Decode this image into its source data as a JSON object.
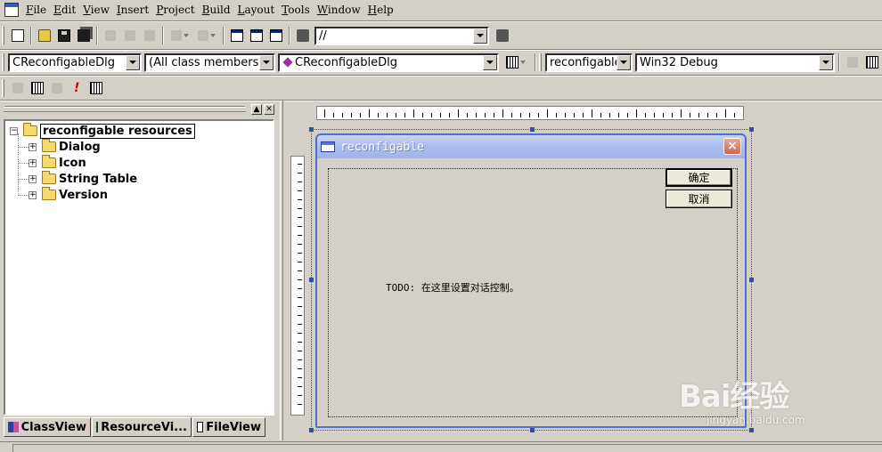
{
  "menu": [
    "File",
    "Edit",
    "View",
    "Insert",
    "Project",
    "Build",
    "Layout",
    "Tools",
    "Window",
    "Help"
  ],
  "toolbar": {
    "find_combo_value": "//",
    "class_combo": "CReconfigableDlg",
    "filter_combo": "(All class members)",
    "member_combo": "CReconfigableDlg",
    "project_combo": "reconfigable",
    "config_combo": "Win32 Debug"
  },
  "tree": {
    "root": "reconfigable resources",
    "items": [
      "Dialog",
      "Icon",
      "String Table",
      "Version"
    ]
  },
  "tabs": [
    "ClassView",
    "ResourceVi...",
    "FileView"
  ],
  "dialog": {
    "title": "reconfigable",
    "close_glyph": "×",
    "ok_label": "确定",
    "cancel_label": "取消",
    "todo_text": "TODO: 在这里设置对话控制。"
  },
  "watermark": {
    "brand": "Bai经验",
    "url": "jingyan.baidu.com"
  },
  "colors": {
    "face": "#d4d0c8",
    "title_gradient": "#a9bdee",
    "selection": "#2b4fb0"
  }
}
